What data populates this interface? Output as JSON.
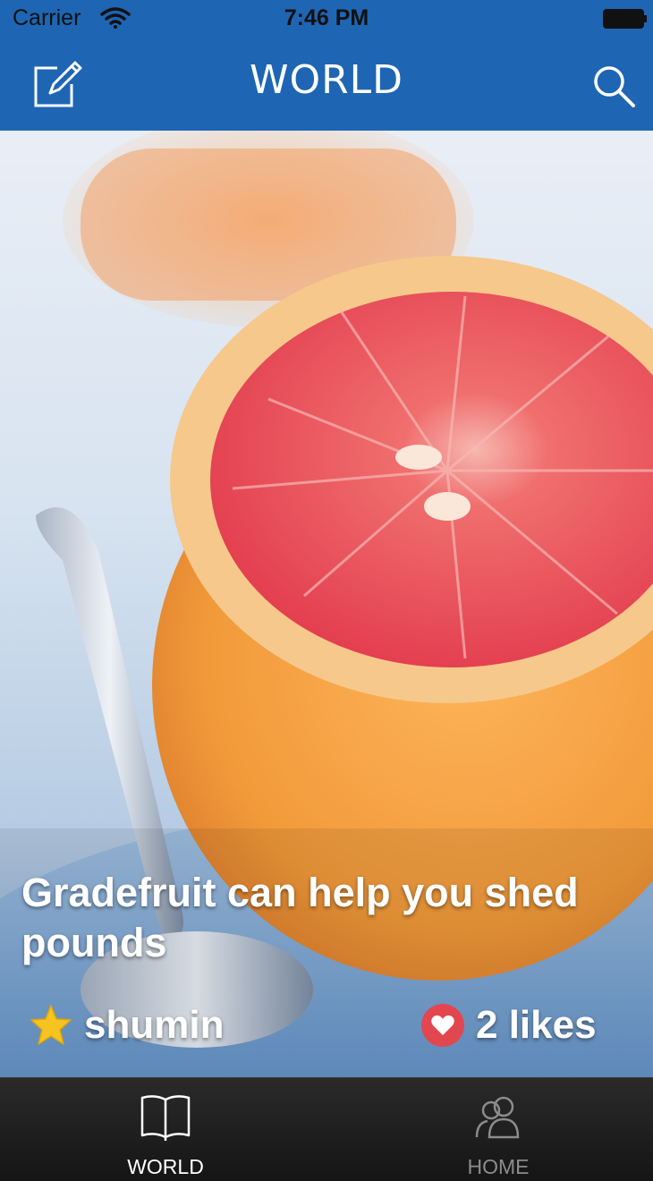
{
  "status_bar": {
    "carrier": "Carrier",
    "time": "7:46 PM"
  },
  "nav_bar": {
    "title": "WORLD",
    "left_icon": "compose-icon",
    "right_icon": "search-icon",
    "background_color": "#1e65b4"
  },
  "card": {
    "title": "Gradefruit can help you shed pounds",
    "author": "shumin",
    "likes": "2 likes",
    "author_icon": "star-icon",
    "likes_icon": "heart-icon",
    "image_subject": "halved grapefruit with spoon"
  },
  "tab_bar": {
    "tabs": [
      {
        "label": "WORLD",
        "icon": "book-icon",
        "selected": true
      },
      {
        "label": "HOME",
        "icon": "users-icon",
        "selected": false
      }
    ]
  }
}
